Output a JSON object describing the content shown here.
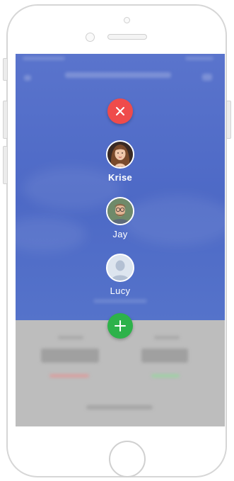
{
  "menu": {
    "close_icon": "close-icon",
    "add_icon": "plus-icon",
    "users": [
      {
        "name": "Krise"
      },
      {
        "name": "Jay"
      },
      {
        "name": "Lucy"
      }
    ]
  },
  "colors": {
    "screen_bg": "#4c68c4",
    "close_button": "#ef4b4b",
    "add_button": "#2db24a",
    "lower_panel": "#bdbdbd"
  }
}
